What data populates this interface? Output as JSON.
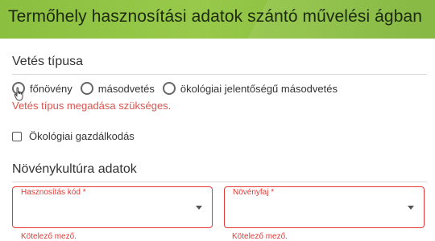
{
  "header": {
    "title": "Termőhely hasznosítási adatok szántó művelési ágban"
  },
  "seeding": {
    "title": "Vetés típusa",
    "options": [
      {
        "label": "főnövény",
        "selected": false
      },
      {
        "label": "másodvetés",
        "selected": false
      },
      {
        "label": "ökológiai jelentőségű másodvetés",
        "selected": false
      }
    ],
    "error": "Vetés típus megadása szükséges."
  },
  "organic": {
    "label": "Ökológiai gazdálkodás",
    "checked": false
  },
  "crop": {
    "title": "Növénykultúra adatok",
    "usage_code": {
      "label": "Hasznosítás kód *",
      "value": "",
      "helper": "Kötelező mező."
    },
    "plant_type": {
      "label": "Növényfaj *",
      "value": "",
      "helper": "Kötelező mező."
    }
  },
  "colors": {
    "header_green": "#8bbf3f",
    "error_red": "#e53935"
  }
}
